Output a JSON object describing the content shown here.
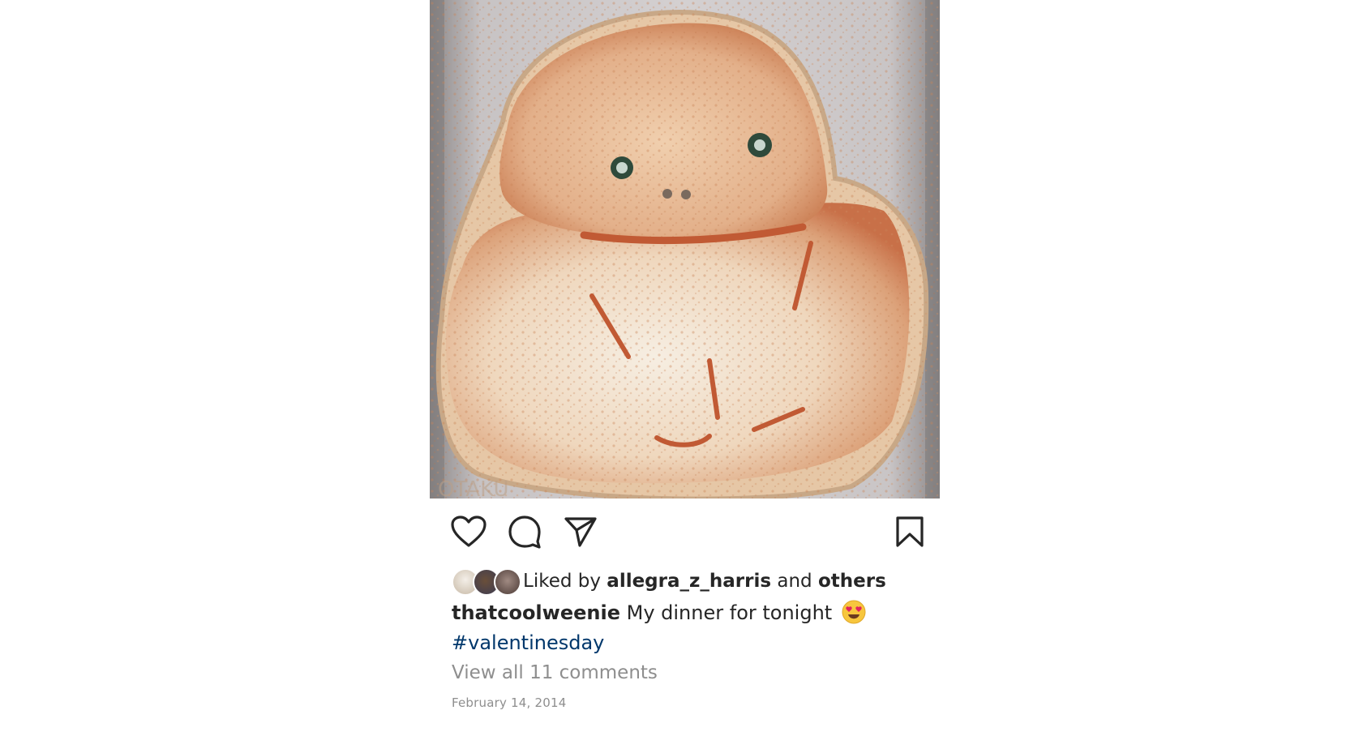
{
  "post": {
    "image_alt": "pizza shaped like a sitting figure in a pizza box",
    "watermark": "OTAKU"
  },
  "actions": {
    "like_icon": "heart-icon",
    "comment_icon": "comment-icon",
    "share_icon": "send-icon",
    "save_icon": "bookmark-icon"
  },
  "likes": {
    "prefix": "Liked by ",
    "user": "allegra_z_harris",
    "middle": " and ",
    "others": "others"
  },
  "caption": {
    "username": "thatcoolweenie",
    "text": " My dinner for tonight",
    "emoji": "heart-eyes-emoji",
    "hashtag": "#valentinesday"
  },
  "comments": {
    "label": "View all 11 comments"
  },
  "date": {
    "label": "February 14, 2014"
  },
  "colors": {
    "hashtag": "#00376b",
    "muted": "#8e8e8e",
    "text": "#262626"
  }
}
